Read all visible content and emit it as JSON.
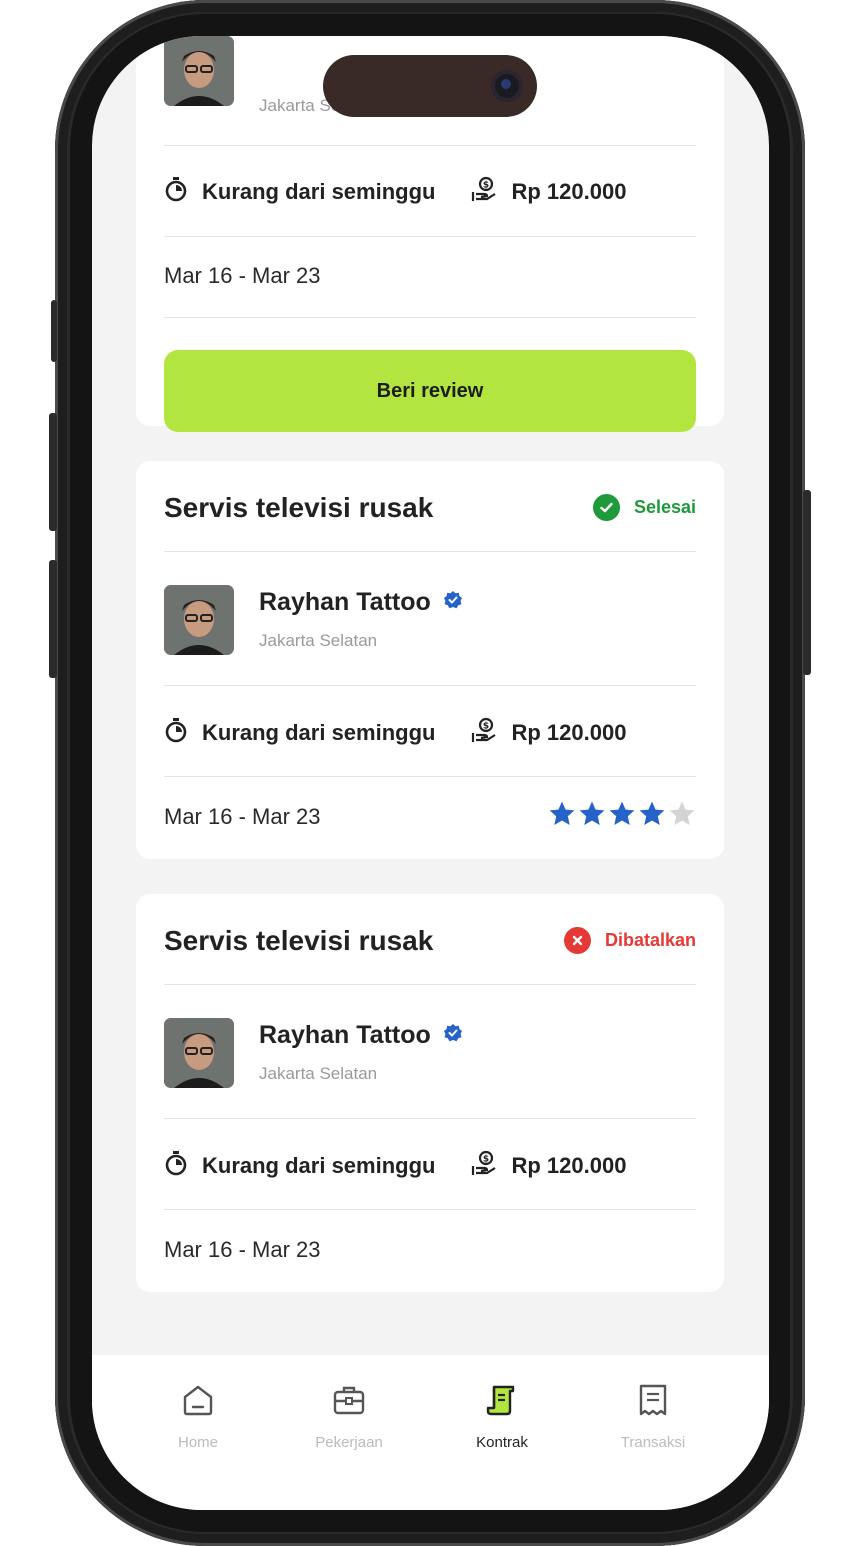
{
  "contracts": [
    {
      "name": "",
      "location": "Jakarta Selatan",
      "duration": "Kurang dari seminggu",
      "price": "Rp 120.000",
      "dates": "Mar 16 - Mar 23",
      "action_label": "Beri review"
    },
    {
      "title": "Servis televisi rusak",
      "status": "Selesai",
      "status_color": "#1f9a3a",
      "name": "Rayhan Tattoo",
      "location": "Jakarta Selatan",
      "duration": "Kurang dari seminggu",
      "price": "Rp 120.000",
      "dates": "Mar 16 - Mar 23",
      "rating": 4,
      "rating_max": 5
    },
    {
      "title": "Servis televisi rusak",
      "status": "Dibatalkan",
      "status_color": "#e53935",
      "name": "Rayhan Tattoo",
      "location": "Jakarta Selatan",
      "duration": "Kurang dari seminggu",
      "price": "Rp 120.000",
      "dates": "Mar 16 - Mar 23"
    }
  ],
  "bottom_nav": [
    {
      "label": "Home",
      "icon": "home-icon",
      "active": false
    },
    {
      "label": "Pekerjaan",
      "icon": "briefcase-icon",
      "active": false
    },
    {
      "label": "Kontrak",
      "icon": "contract-icon",
      "active": true
    },
    {
      "label": "Transaksi",
      "icon": "receipt-icon",
      "active": false
    }
  ],
  "colors": {
    "accent": "#b2e53f",
    "star_filled": "#2563c9",
    "star_empty": "#d4d4d4",
    "verified": "#2563c9"
  }
}
